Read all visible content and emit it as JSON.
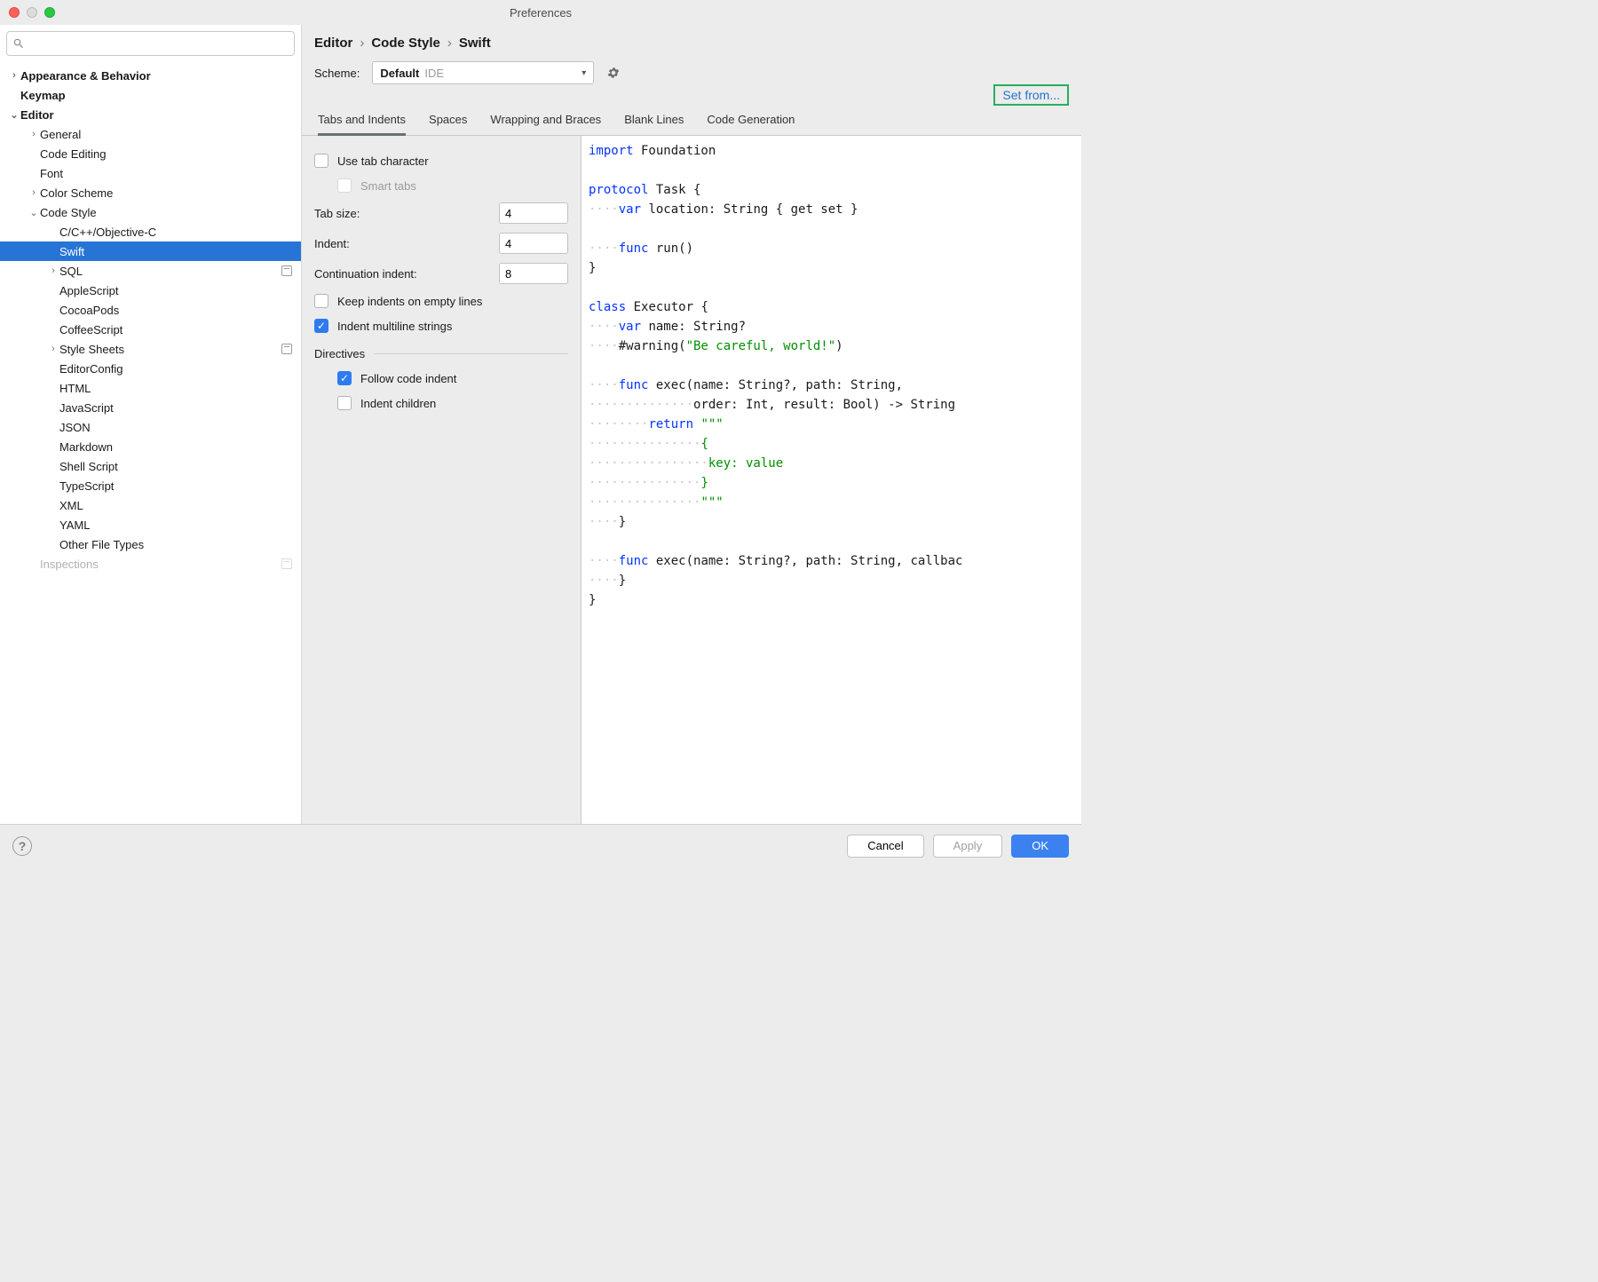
{
  "window": {
    "title": "Preferences"
  },
  "sidebar": {
    "search_placeholder": "",
    "items": [
      {
        "label": "Appearance & Behavior",
        "level": 0,
        "chev": "›",
        "bold": true
      },
      {
        "label": "Keymap",
        "level": 0,
        "chev": "",
        "bold": true
      },
      {
        "label": "Editor",
        "level": 0,
        "chev": "⌄",
        "bold": true
      },
      {
        "label": "General",
        "level": 1,
        "chev": "›"
      },
      {
        "label": "Code Editing",
        "level": 1,
        "chev": ""
      },
      {
        "label": "Font",
        "level": 1,
        "chev": ""
      },
      {
        "label": "Color Scheme",
        "level": 1,
        "chev": "›"
      },
      {
        "label": "Code Style",
        "level": 1,
        "chev": "⌄"
      },
      {
        "label": "C/C++/Objective-C",
        "level": 2,
        "chev": ""
      },
      {
        "label": "Swift",
        "level": 2,
        "chev": "",
        "selected": true
      },
      {
        "label": "SQL",
        "level": 2,
        "chev": "›",
        "badge": true
      },
      {
        "label": "AppleScript",
        "level": 2,
        "chev": ""
      },
      {
        "label": "CocoaPods",
        "level": 2,
        "chev": ""
      },
      {
        "label": "CoffeeScript",
        "level": 2,
        "chev": ""
      },
      {
        "label": "Style Sheets",
        "level": 2,
        "chev": "›",
        "badge": true
      },
      {
        "label": "EditorConfig",
        "level": 2,
        "chev": ""
      },
      {
        "label": "HTML",
        "level": 2,
        "chev": ""
      },
      {
        "label": "JavaScript",
        "level": 2,
        "chev": ""
      },
      {
        "label": "JSON",
        "level": 2,
        "chev": ""
      },
      {
        "label": "Markdown",
        "level": 2,
        "chev": ""
      },
      {
        "label": "Shell Script",
        "level": 2,
        "chev": ""
      },
      {
        "label": "TypeScript",
        "level": 2,
        "chev": ""
      },
      {
        "label": "XML",
        "level": 2,
        "chev": ""
      },
      {
        "label": "YAML",
        "level": 2,
        "chev": ""
      },
      {
        "label": "Other File Types",
        "level": 2,
        "chev": ""
      },
      {
        "label": "Inspections",
        "level": 1,
        "chev": "",
        "badge": true,
        "faded": true
      }
    ]
  },
  "breadcrumbs": [
    "Editor",
    "Code Style",
    "Swift"
  ],
  "scheme": {
    "label": "Scheme:",
    "value": "Default",
    "tag": "IDE"
  },
  "setfrom": "Set from...",
  "tabs": [
    "Tabs and Indents",
    "Spaces",
    "Wrapping and Braces",
    "Blank Lines",
    "Code Generation"
  ],
  "active_tab": 0,
  "settings": {
    "use_tab": {
      "label": "Use tab character",
      "checked": false
    },
    "smart_tabs": {
      "label": "Smart tabs",
      "checked": false,
      "disabled": true
    },
    "tab_size": {
      "label": "Tab size:",
      "value": "4"
    },
    "indent": {
      "label": "Indent:",
      "value": "4"
    },
    "cont_indent": {
      "label": "Continuation indent:",
      "value": "8"
    },
    "keep_empty": {
      "label": "Keep indents on empty lines",
      "checked": false
    },
    "indent_multiline": {
      "label": "Indent multiline strings",
      "checked": true
    },
    "directives_title": "Directives",
    "follow_code": {
      "label": "Follow code indent",
      "checked": true
    },
    "indent_children": {
      "label": "Indent children",
      "checked": false
    }
  },
  "preview": {
    "lines": [
      [
        {
          "t": "import",
          "c": "kw"
        },
        {
          "t": " Foundation"
        }
      ],
      [],
      [
        {
          "t": "protocol",
          "c": "kw"
        },
        {
          "t": " Task {"
        }
      ],
      [
        {
          "t": "····",
          "c": "ws"
        },
        {
          "t": "var",
          "c": "kw"
        },
        {
          "t": " location: String { get set }"
        }
      ],
      [],
      [
        {
          "t": "····",
          "c": "ws"
        },
        {
          "t": "func",
          "c": "kw"
        },
        {
          "t": " run()"
        }
      ],
      [
        {
          "t": "}"
        }
      ],
      [],
      [
        {
          "t": "class",
          "c": "kw"
        },
        {
          "t": " Executor {"
        }
      ],
      [
        {
          "t": "····",
          "c": "ws"
        },
        {
          "t": "var",
          "c": "kw"
        },
        {
          "t": " name: String?"
        }
      ],
      [
        {
          "t": "····",
          "c": "ws"
        },
        {
          "t": "#warning(",
          "c": ""
        },
        {
          "t": "\"Be careful, world!\"",
          "c": "str"
        },
        {
          "t": ")"
        }
      ],
      [],
      [
        {
          "t": "····",
          "c": "ws"
        },
        {
          "t": "func",
          "c": "kw"
        },
        {
          "t": " exec(name: String?, path: String,"
        }
      ],
      [
        {
          "t": "··············",
          "c": "ws"
        },
        {
          "t": "order: Int, result: Bool) -> String "
        }
      ],
      [
        {
          "t": "········",
          "c": "ws"
        },
        {
          "t": "return",
          "c": "kw"
        },
        {
          "t": " "
        },
        {
          "t": "\"\"\"",
          "c": "str"
        }
      ],
      [
        {
          "t": "···············",
          "c": "ws"
        },
        {
          "t": "{",
          "c": "str"
        }
      ],
      [
        {
          "t": "················",
          "c": "ws"
        },
        {
          "t": "key: value",
          "c": "str"
        }
      ],
      [
        {
          "t": "···············",
          "c": "ws"
        },
        {
          "t": "}",
          "c": "str"
        }
      ],
      [
        {
          "t": "···············",
          "c": "ws"
        },
        {
          "t": "\"\"\"",
          "c": "str"
        }
      ],
      [
        {
          "t": "····",
          "c": "ws"
        },
        {
          "t": "}"
        }
      ],
      [],
      [
        {
          "t": "····",
          "c": "ws"
        },
        {
          "t": "func",
          "c": "kw"
        },
        {
          "t": " exec(name: String?, path: String, callbac"
        }
      ],
      [
        {
          "t": "····",
          "c": "ws"
        },
        {
          "t": "}"
        }
      ],
      [
        {
          "t": "}"
        }
      ]
    ]
  },
  "footer": {
    "cancel": "Cancel",
    "apply": "Apply",
    "ok": "OK"
  }
}
